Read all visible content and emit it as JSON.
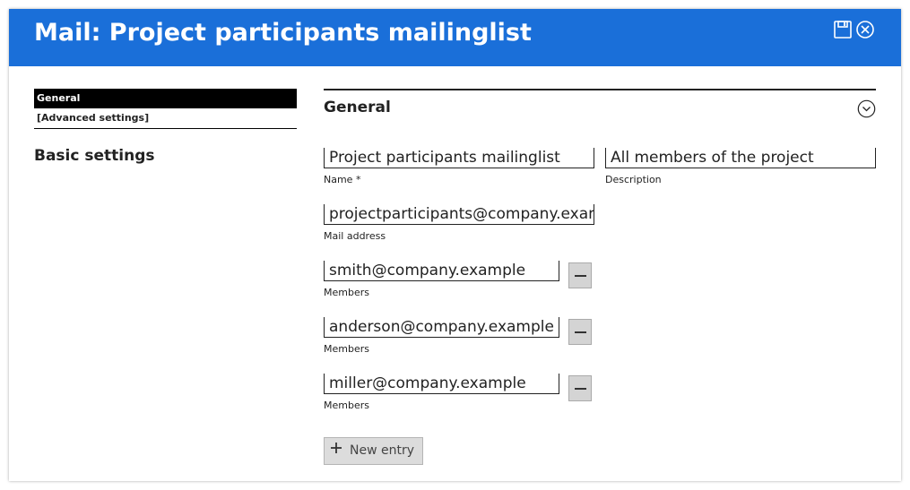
{
  "window": {
    "title": "Mail: Project participants mailinglist",
    "save_icon": "save-icon",
    "close_icon": "close-circle-icon",
    "accent_color": "#1a6fd9"
  },
  "sidebar": {
    "items": [
      {
        "label": "General",
        "active": true
      },
      {
        "label": "[Advanced settings]",
        "active": false
      }
    ],
    "heading": "Basic settings"
  },
  "section": {
    "title": "General",
    "collapse_icon": "chevron-circle-down-icon"
  },
  "fields": {
    "name": {
      "value": "Project participants mailinglist",
      "label": "Name *"
    },
    "description": {
      "value": "All members of the project",
      "label": "Description"
    },
    "mail_address": {
      "value": "projectparticipants@company.example",
      "label": "Mail address"
    }
  },
  "members": [
    {
      "value": "smith@company.example",
      "label": "Members"
    },
    {
      "value": "anderson@company.example",
      "label": "Members"
    },
    {
      "value": "miller@company.example",
      "label": "Members"
    }
  ],
  "new_entry": {
    "label": "New entry",
    "icon": "plus-icon"
  }
}
